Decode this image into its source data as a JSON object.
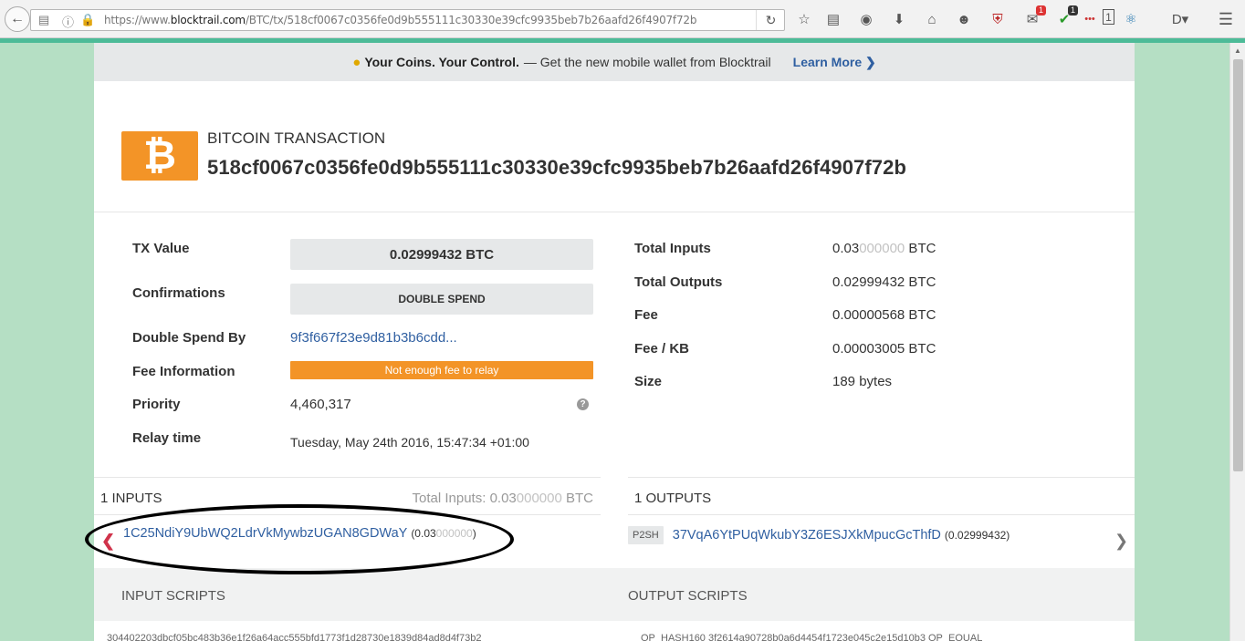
{
  "browser": {
    "url_prefix": "https://www.",
    "url_domain": "blocktrail.com",
    "url_path": "/BTC/tx/518cf0067c0356fe0d9b555111c30330e39cfc9935beb7b26aafd26f4907f72b",
    "badges": {
      "mail": "1",
      "shield": "1",
      "counter": "1"
    }
  },
  "promo": {
    "bold_text": "Your Coins. Your Control.",
    "text": "— Get the new mobile wallet from Blocktrail",
    "link": "Learn More"
  },
  "transaction": {
    "label": "BITCOIN TRANSACTION",
    "hash": "518cf0067c0356fe0d9b555111c30330e39cfc9935beb7b26aafd26f4907f72b"
  },
  "details_left": {
    "tx_value_label": "TX Value",
    "tx_value": "0.02999432 BTC",
    "confirmations_label": "Confirmations",
    "confirmations": "DOUBLE SPEND",
    "double_spend_label": "Double Spend By",
    "double_spend": "9f3f667f23e9d81b3b6cdd...",
    "fee_info_label": "Fee Information",
    "fee_info": "Not enough fee to relay",
    "priority_label": "Priority",
    "priority": "4,460,317",
    "relay_label": "Relay time",
    "relay": "Tuesday, May 24th 2016, 15:47:34 +01:00"
  },
  "details_right": {
    "total_inputs_label": "Total Inputs",
    "total_inputs_main": "0.03",
    "total_inputs_faint": "000000",
    "total_inputs_unit": " BTC",
    "total_outputs_label": "Total Outputs",
    "total_outputs": "0.02999432 BTC",
    "fee_label": "Fee",
    "fee": "0.00000568 BTC",
    "fee_kb_label": "Fee / KB",
    "fee_kb": "0.00003005 BTC",
    "size_label": "Size",
    "size": "189 bytes"
  },
  "inputs": {
    "title": "1 INPUTS",
    "total_prefix": "Total Inputs: 0.03",
    "total_faint": "000000",
    "total_unit": " BTC",
    "address": "1C25NdiY9UbWQ2LdrVkMywbzUGAN8GDWaY",
    "amount_open": "(0.03",
    "amount_faint": "000000",
    "amount_close": ")"
  },
  "outputs": {
    "title": "1 OUTPUTS",
    "type": "P2SH",
    "address": "37VqA6YtPUqWkubY3Z6ESJXkMpucGcThfD",
    "amount": "(0.02999432)"
  },
  "scripts": {
    "input_title": "INPUT SCRIPTS",
    "output_title": "OUTPUT SCRIPTS",
    "input_preview": "304402203dbcf05bc483b36e1f26a64acc555bfd1773f1d28730e1839d84ad8d4f73b2",
    "output_preview": "OP_HASH160 3f2614a90728b0a6d4454f1723e045c2e15d10b3 OP_EQUAL"
  }
}
